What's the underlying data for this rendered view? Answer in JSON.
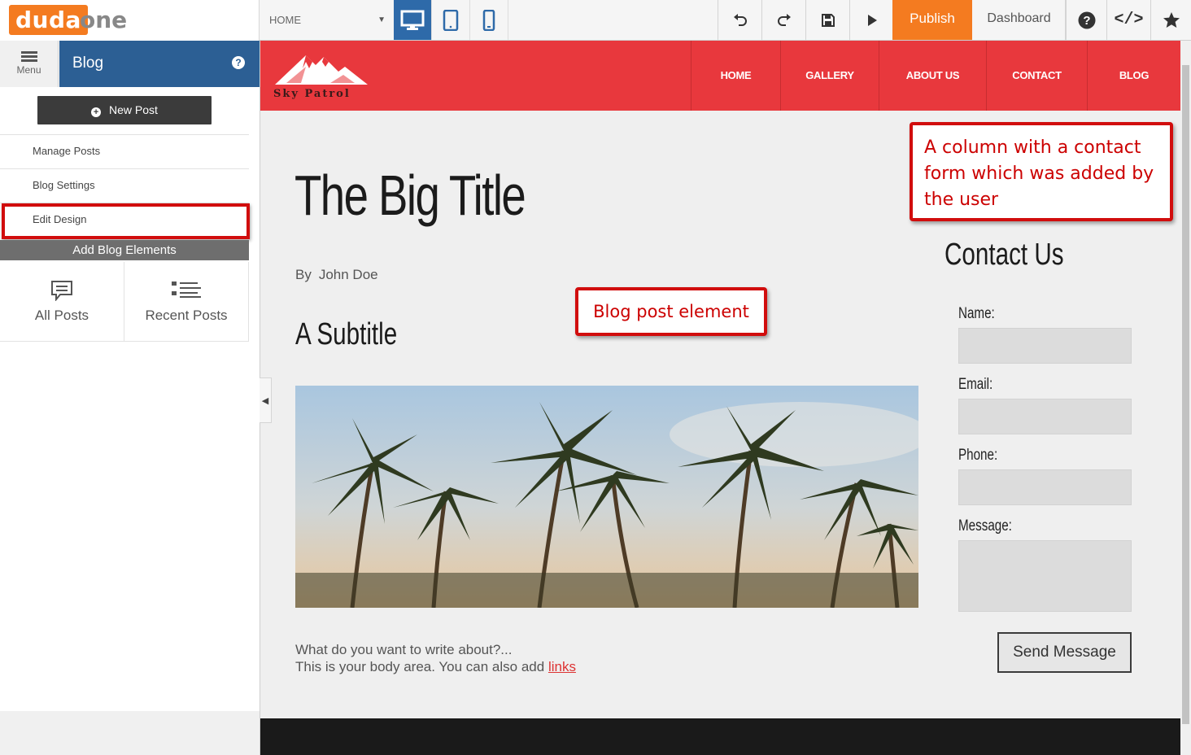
{
  "topbar": {
    "logo_part1": "duda",
    "logo_part2": "one",
    "page_select": "HOME",
    "devices": [
      "desktop-icon",
      "tablet-icon",
      "mobile-icon"
    ],
    "publish_label": "Publish",
    "dashboard_label": "Dashboard",
    "code_label": "</>",
    "accent_color": "#f47b20"
  },
  "sidebar": {
    "menu_label": "Menu",
    "panel_title": "Blog",
    "new_post_label": "New Post",
    "items": [
      {
        "label": "Manage Posts"
      },
      {
        "label": "Blog Settings"
      },
      {
        "label": "Edit Design"
      }
    ],
    "add_elements_label": "Add Blog Elements",
    "tiles": [
      {
        "label": "All Posts",
        "icon": "comment-icon"
      },
      {
        "label": "Recent Posts",
        "icon": "list-icon"
      }
    ],
    "header_color": "#2c5f94"
  },
  "site": {
    "brand_text": "Sky Patrol",
    "nav": [
      "HOME",
      "GALLERY",
      "ABOUT US",
      "CONTACT",
      "BLOG"
    ],
    "header_color": "#e8383d",
    "post_title": "The Big Title",
    "by_label": "By",
    "author": "John Doe",
    "subtitle": "A Subtitle",
    "body_line1": "What do you want to write about?...",
    "body_line2": "This is your body area. You can also add",
    "body_link": "links",
    "contact_title": "Contact Us",
    "form": {
      "name_label": "Name:",
      "email_label": "Email:",
      "phone_label": "Phone:",
      "message_label": "Message:",
      "send_label": "Send Message"
    }
  },
  "annotations": {
    "column_note": "A column with a contact form which was added by the user",
    "blog_note": "Blog post element"
  }
}
